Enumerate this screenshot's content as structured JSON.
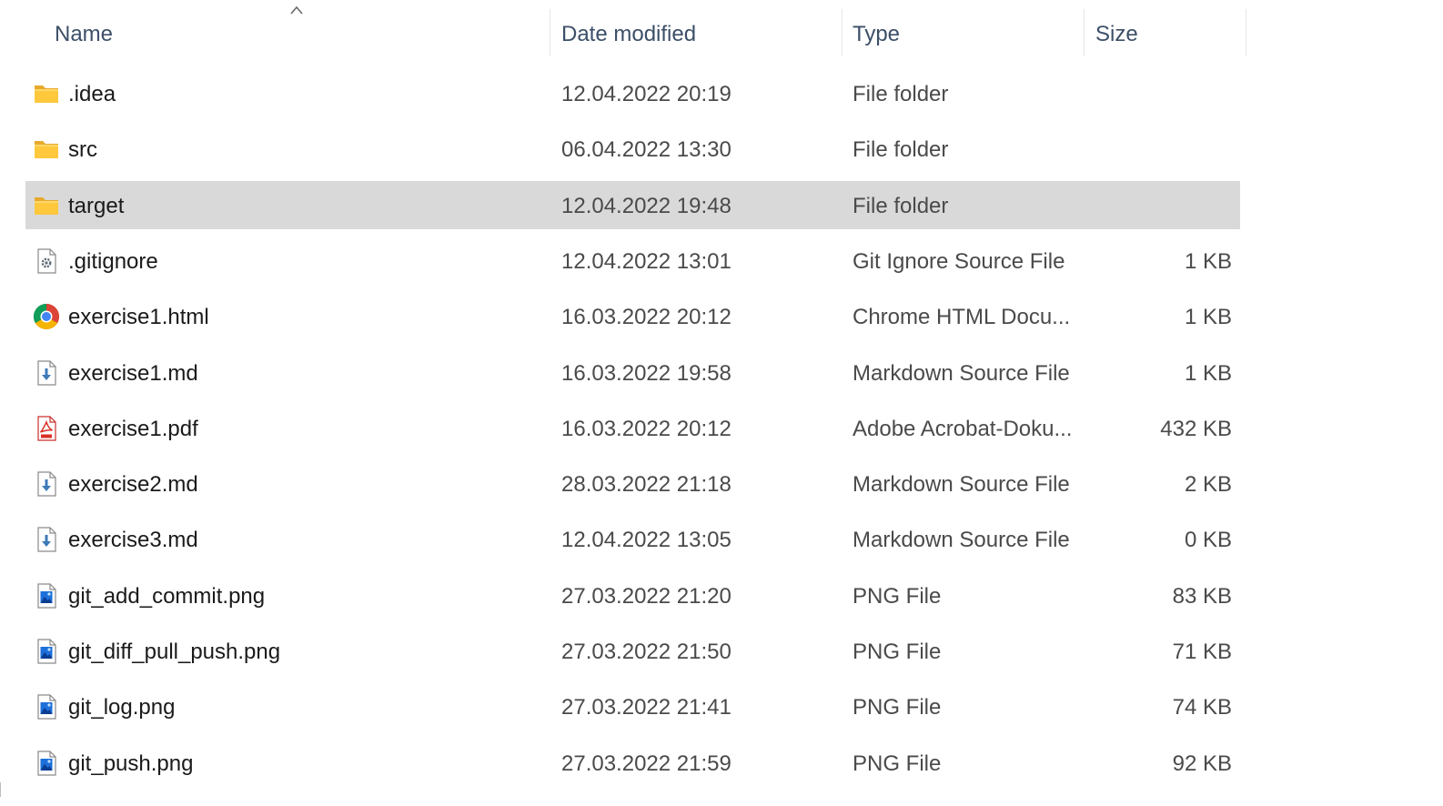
{
  "header": {
    "name_label": "Name",
    "date_label": "Date modified",
    "type_label": "Type",
    "size_label": "Size",
    "sort_indicator": "sort-ascending-chevron-icon"
  },
  "colors": {
    "selection_bg": "#d9d9d9",
    "header_text": "#3c4f68",
    "folder_yellow": "#ffc83d"
  },
  "files": [
    {
      "name": ".idea",
      "date": "12.04.2022 20:19",
      "type": "File folder",
      "size": "",
      "icon": "folder-icon",
      "selected": false
    },
    {
      "name": "src",
      "date": "06.04.2022 13:30",
      "type": "File folder",
      "size": "",
      "icon": "folder-icon",
      "selected": false
    },
    {
      "name": "target",
      "date": "12.04.2022 19:48",
      "type": "File folder",
      "size": "",
      "icon": "folder-icon",
      "selected": true
    },
    {
      "name": ".gitignore",
      "date": "12.04.2022 13:01",
      "type": "Git Ignore Source File",
      "size": "1 KB",
      "icon": "settings-file-icon",
      "selected": false
    },
    {
      "name": "exercise1.html",
      "date": "16.03.2022 20:12",
      "type": "Chrome HTML Docu...",
      "size": "1 KB",
      "icon": "chrome-icon",
      "selected": false
    },
    {
      "name": "exercise1.md",
      "date": "16.03.2022 19:58",
      "type": "Markdown Source File",
      "size": "1 KB",
      "icon": "markdown-file-icon",
      "selected": false
    },
    {
      "name": "exercise1.pdf",
      "date": "16.03.2022 20:12",
      "type": "Adobe Acrobat-Doku...",
      "size": "432 KB",
      "icon": "pdf-file-icon",
      "selected": false
    },
    {
      "name": "exercise2.md",
      "date": "28.03.2022 21:18",
      "type": "Markdown Source File",
      "size": "2 KB",
      "icon": "markdown-file-icon",
      "selected": false
    },
    {
      "name": "exercise3.md",
      "date": "12.04.2022 13:05",
      "type": "Markdown Source File",
      "size": "0 KB",
      "icon": "markdown-file-icon",
      "selected": false
    },
    {
      "name": "git_add_commit.png",
      "date": "27.03.2022 21:20",
      "type": "PNG File",
      "size": "83 KB",
      "icon": "image-file-icon",
      "selected": false
    },
    {
      "name": "git_diff_pull_push.png",
      "date": "27.03.2022 21:50",
      "type": "PNG File",
      "size": "71 KB",
      "icon": "image-file-icon",
      "selected": false
    },
    {
      "name": "git_log.png",
      "date": "27.03.2022 21:41",
      "type": "PNG File",
      "size": "74 KB",
      "icon": "image-file-icon",
      "selected": false
    },
    {
      "name": "git_push.png",
      "date": "27.03.2022 21:59",
      "type": "PNG File",
      "size": "92 KB",
      "icon": "image-file-icon",
      "selected": false
    }
  ]
}
